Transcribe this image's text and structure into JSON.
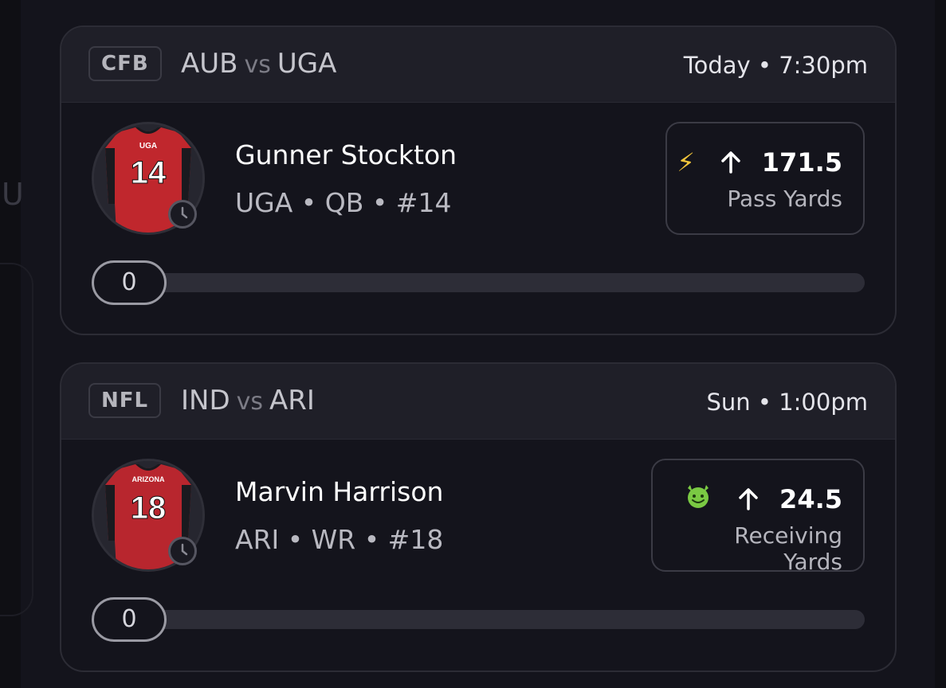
{
  "background_ghost": {
    "letter": "U"
  },
  "cards": [
    {
      "league": "CFB",
      "team_a": "AUB",
      "vs": "vs",
      "team_b": "UGA",
      "game_time": "Today • 7:30pm",
      "player": {
        "name": "Gunner Stockton",
        "meta": "UGA • QB • #14",
        "jersey_team": "UGA",
        "jersey_number": "14"
      },
      "prop": {
        "emoji": "⚡",
        "value": "171.5",
        "label": "Pass Yards"
      },
      "progress": {
        "value": "0"
      }
    },
    {
      "league": "NFL",
      "team_a": "IND",
      "vs": "vs",
      "team_b": "ARI",
      "game_time": "Sun • 1:00pm",
      "player": {
        "name": "Marvin Harrison",
        "meta": "ARI • WR • #18",
        "jersey_team": "ARIZONA",
        "jersey_number": "18"
      },
      "prop": {
        "emoji": "😈",
        "value": "24.5",
        "label": "Receiving Yards"
      },
      "progress": {
        "value": "0"
      }
    }
  ],
  "colors": {
    "background": "#0f0f14",
    "card": "#14141c",
    "card_header": "#1f1f28",
    "jersey_red": "#c0272d",
    "emoji_green": "#7ac943"
  },
  "icons": [
    "lightning-icon",
    "devil-emoji-icon",
    "arrow-up-icon",
    "clock-icon",
    "jersey-icon"
  ]
}
